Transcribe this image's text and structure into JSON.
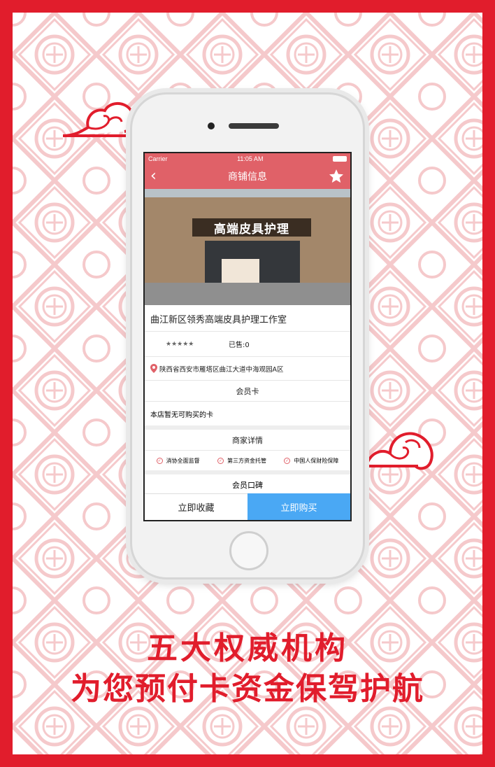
{
  "colors": {
    "border": "#e11d2c",
    "nav": "#e06168",
    "buy": "#4aa8f4"
  },
  "status_bar": {
    "carrier": "Carrier",
    "time": "11:05 AM"
  },
  "nav": {
    "title": "商铺信息",
    "back_icon": "chevron-left-icon",
    "fav_icon": "star-icon"
  },
  "photo": {
    "sign_text": "高端皮具护理"
  },
  "shop": {
    "name": "曲江新区领秀高端皮具护理工作室",
    "stars": "★★★★★",
    "sold": "已售:0",
    "address": "陕西省西安市雁塔区曲江大道中海观园A区"
  },
  "membership": {
    "title": "会员卡",
    "empty_text": "本店暂无可购买的卡"
  },
  "details": {
    "title": "商家详情",
    "guarantees": [
      "消协全面监督",
      "第三方资金托管",
      "中国人保财险保障"
    ]
  },
  "reviews": {
    "title": "会员口碑"
  },
  "bottom": {
    "favorite": "立即收藏",
    "buy": "立即购买"
  },
  "headline": {
    "line1": "五大权威机构",
    "line2": "为您预付卡资金保驾护航"
  }
}
